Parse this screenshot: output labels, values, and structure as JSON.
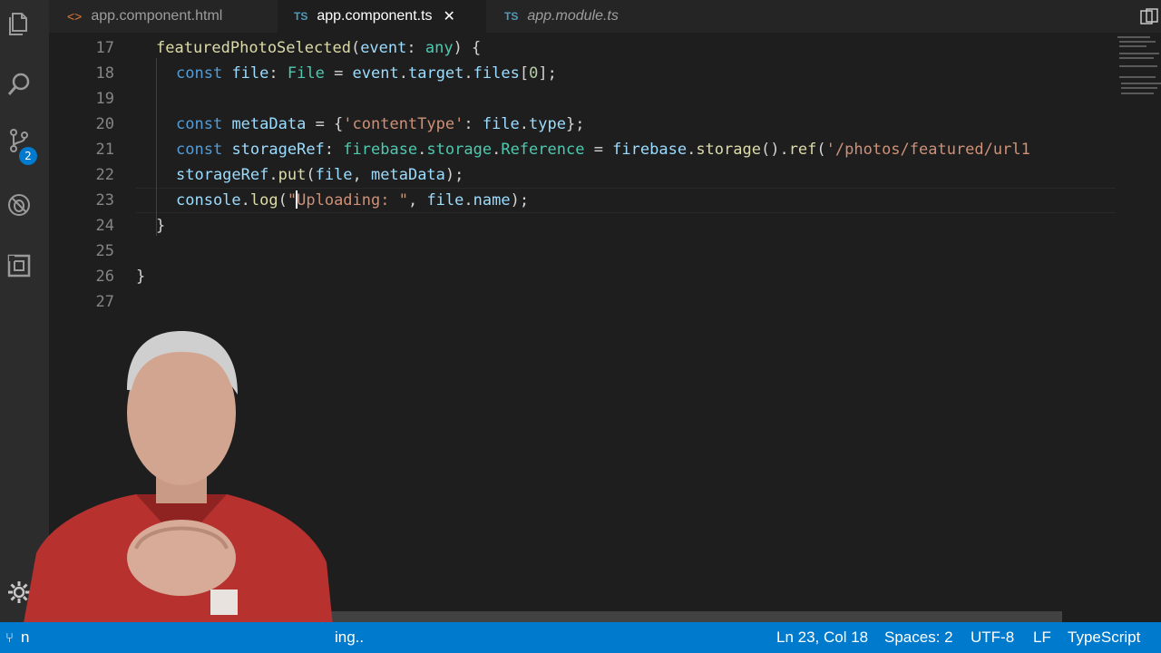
{
  "tabs": [
    {
      "label": "app.component.html",
      "kind": "html",
      "icon": "html-code-icon",
      "active": false,
      "italic": false
    },
    {
      "label": "app.component.ts",
      "kind": "ts",
      "badge": "TS",
      "active": true,
      "italic": false
    },
    {
      "label": "app.module.ts",
      "kind": "ts",
      "badge": "TS",
      "active": false,
      "italic": true
    }
  ],
  "activity_bar": {
    "icons": [
      "explorer-icon",
      "search-icon",
      "source-control-icon",
      "debug-icon",
      "extensions-icon",
      "settings-gear-icon"
    ],
    "scm_badge": "2"
  },
  "editor": {
    "line_numbers": [
      "17",
      "18",
      "19",
      "20",
      "21",
      "22",
      "23",
      "24",
      "25",
      "26",
      "27"
    ],
    "lines": [
      [
        [
          "fn",
          "featuredPhotoSelected"
        ],
        [
          "pn",
          "("
        ],
        [
          "var",
          "event"
        ],
        [
          "pn",
          ": "
        ],
        [
          "ty",
          "any"
        ],
        [
          "pn",
          ") {"
        ]
      ],
      [
        [
          "kw",
          "const"
        ],
        [
          "pn",
          " "
        ],
        [
          "var",
          "file"
        ],
        [
          "pn",
          ": "
        ],
        [
          "ty",
          "File"
        ],
        [
          "pn",
          " = "
        ],
        [
          "var",
          "event"
        ],
        [
          "pn",
          "."
        ],
        [
          "var",
          "target"
        ],
        [
          "pn",
          "."
        ],
        [
          "var",
          "files"
        ],
        [
          "pn",
          "["
        ],
        [
          "num",
          "0"
        ],
        [
          "pn",
          "];"
        ]
      ],
      [],
      [
        [
          "kw",
          "const"
        ],
        [
          "pn",
          " "
        ],
        [
          "var",
          "metaData"
        ],
        [
          "pn",
          " = {"
        ],
        [
          "str",
          "'contentType'"
        ],
        [
          "pn",
          ": "
        ],
        [
          "var",
          "file"
        ],
        [
          "pn",
          "."
        ],
        [
          "var",
          "type"
        ],
        [
          "pn",
          "};"
        ]
      ],
      [
        [
          "kw",
          "const"
        ],
        [
          "pn",
          " "
        ],
        [
          "var",
          "storageRef"
        ],
        [
          "pn",
          ": "
        ],
        [
          "ty",
          "firebase"
        ],
        [
          "pn",
          "."
        ],
        [
          "ty",
          "storage"
        ],
        [
          "pn",
          "."
        ],
        [
          "ty",
          "Reference"
        ],
        [
          "pn",
          " = "
        ],
        [
          "var",
          "firebase"
        ],
        [
          "pn",
          "."
        ],
        [
          "fn",
          "storage"
        ],
        [
          "pn",
          "()."
        ],
        [
          "fn",
          "ref"
        ],
        [
          "pn",
          "("
        ],
        [
          "str",
          "'/photos/featured/url1"
        ]
      ],
      [
        [
          "var",
          "storageRef"
        ],
        [
          "pn",
          "."
        ],
        [
          "fn",
          "put"
        ],
        [
          "pn",
          "("
        ],
        [
          "var",
          "file"
        ],
        [
          "pn",
          ", "
        ],
        [
          "var",
          "metaData"
        ],
        [
          "pn",
          ");"
        ]
      ],
      [
        [
          "var",
          "console"
        ],
        [
          "pn",
          "."
        ],
        [
          "fn",
          "log"
        ],
        [
          "pn",
          "("
        ],
        [
          "str",
          "\""
        ],
        [
          "caret",
          ""
        ],
        [
          "str",
          "Uploading: \""
        ],
        [
          "pn",
          ", "
        ],
        [
          "var",
          "file"
        ],
        [
          "pn",
          "."
        ],
        [
          "var",
          "name"
        ],
        [
          "pn",
          ");"
        ]
      ],
      [
        [
          "pn",
          "}"
        ]
      ],
      [],
      [
        [
          "pn",
          "}"
        ]
      ],
      []
    ],
    "indents": [
      0,
      1,
      0,
      1,
      1,
      1,
      1,
      0,
      0,
      -1,
      0
    ]
  },
  "status_bar": {
    "branch_fragment": "n",
    "message_fragment": "ing..",
    "position": "Ln 23, Col 18",
    "spaces": "Spaces: 2",
    "encoding": "UTF-8",
    "eol": "LF",
    "language": "TypeScript"
  }
}
